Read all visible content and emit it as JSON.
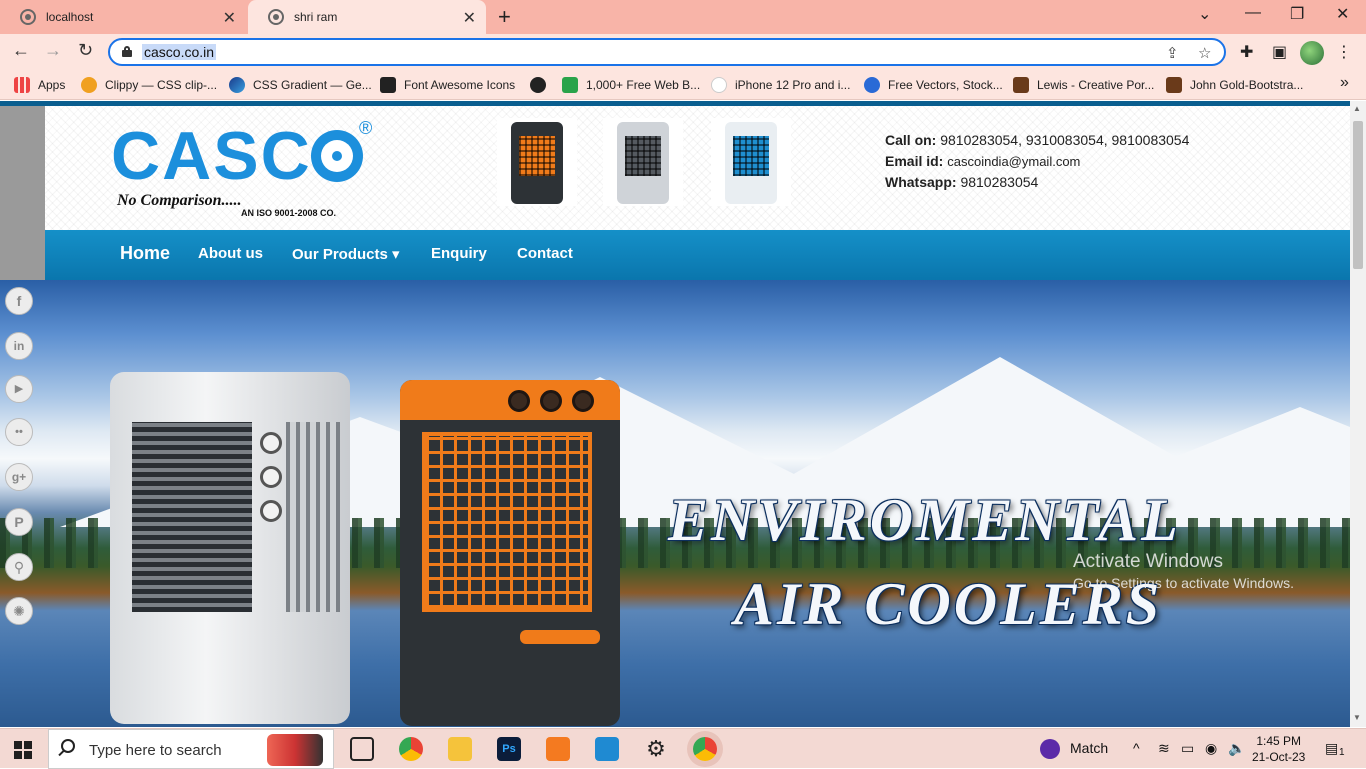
{
  "browser": {
    "tabs": [
      {
        "title": "localhost"
      },
      {
        "title": "shri ram"
      }
    ],
    "url": "casco.co.in",
    "bookmarks": [
      {
        "label": "Apps",
        "color": "#e44"
      },
      {
        "label": "Clippy — CSS clip-...",
        "color": "#f0a020"
      },
      {
        "label": "CSS Gradient — Ge...",
        "color": "#1a3a8a"
      },
      {
        "label": "Font Awesome Icons",
        "color": "#222"
      },
      {
        "label": "",
        "color": "#222"
      },
      {
        "label": "1,000+ Free Web B...",
        "color": "#2aa34a"
      },
      {
        "label": "iPhone 12 Pro and i...",
        "color": "#222"
      },
      {
        "label": "Free Vectors, Stock...",
        "color": "#2a6ad6"
      },
      {
        "label": "Lewis - Creative Por...",
        "color": "#6a3a1a"
      },
      {
        "label": "John Gold-Bootstra...",
        "color": "#6a3a1a"
      }
    ],
    "more_bookmarks": "»"
  },
  "site": {
    "logo_text": "CASC",
    "registered": "®",
    "tagline": "No Comparison.....",
    "iso": "AN ISO 9001-2008 CO.",
    "contact": {
      "call_label": "Call on:",
      "call_value": "9810283054, 9310083054, 9810083054",
      "email_label": "Email id:",
      "email_value": "cascoindia@ymail.com",
      "whatsapp_label": "Whatsapp:",
      "whatsapp_value": "9810283054"
    },
    "nav": [
      {
        "label": "Home"
      },
      {
        "label": "About us"
      },
      {
        "label": "Our Products ▾"
      },
      {
        "label": "Enquiry"
      },
      {
        "label": "Contact"
      }
    ],
    "hero": {
      "line1": "ENVIROMENTAL",
      "line2": "AIR COOLERS"
    }
  },
  "social": [
    {
      "icon": "facebook-icon",
      "glyph": "f"
    },
    {
      "icon": "linkedin-icon",
      "glyph": "in"
    },
    {
      "icon": "youtube-icon",
      "glyph": "▶"
    },
    {
      "icon": "flickr-icon",
      "glyph": "••"
    },
    {
      "icon": "googleplus-icon",
      "glyph": "g+"
    },
    {
      "icon": "pinterest-icon",
      "glyph": "P"
    },
    {
      "icon": "location-icon",
      "glyph": "⚲"
    },
    {
      "icon": "stamp-icon",
      "glyph": "✺"
    }
  ],
  "watermark": {
    "title": "Activate Windows",
    "subtitle": "Go to Settings to activate Windows."
  },
  "taskbar": {
    "search_placeholder": "Type here to search",
    "match_label": "Match",
    "time": "1:45 PM",
    "date": "21-Oct-23",
    "notification_count": "1"
  }
}
